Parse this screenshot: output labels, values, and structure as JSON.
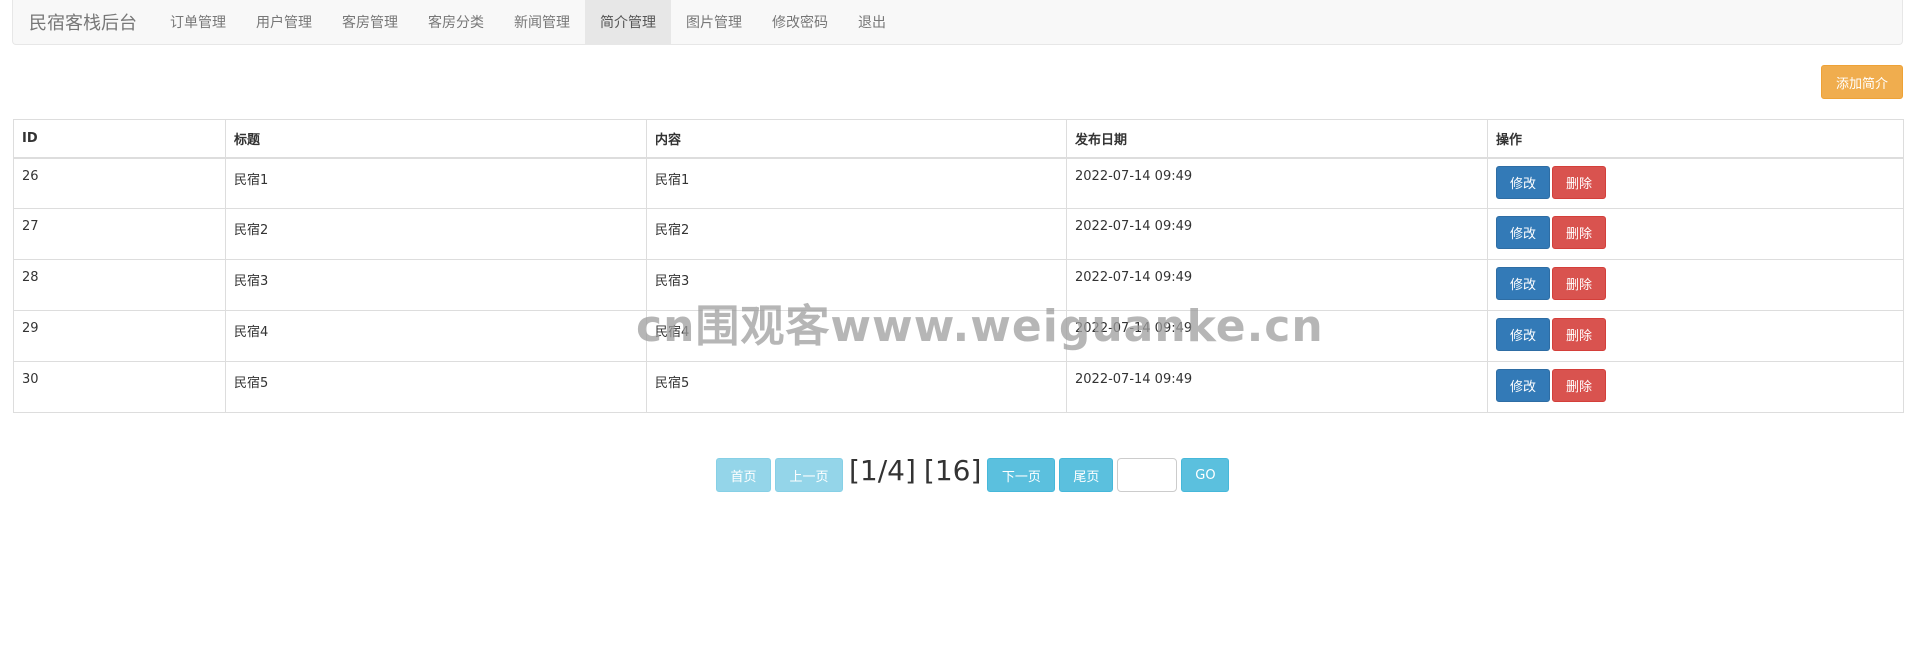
{
  "navbar": {
    "brand": "民宿客栈后台",
    "items": [
      {
        "label": "订单管理",
        "active": false
      },
      {
        "label": "用户管理",
        "active": false
      },
      {
        "label": "客房管理",
        "active": false
      },
      {
        "label": "客房分类",
        "active": false
      },
      {
        "label": "新闻管理",
        "active": false
      },
      {
        "label": "简介管理",
        "active": true
      },
      {
        "label": "图片管理",
        "active": false
      },
      {
        "label": "修改密码",
        "active": false
      },
      {
        "label": "退出",
        "active": false
      }
    ]
  },
  "toolbar": {
    "add_label": "添加简介"
  },
  "table": {
    "headers": [
      "ID",
      "标题",
      "内容",
      "发布日期",
      "操作"
    ],
    "edit_label": "修改",
    "delete_label": "删除",
    "rows": [
      {
        "id": "26",
        "title": "民宿1",
        "content": "民宿1",
        "date": "2022-07-14 09:49"
      },
      {
        "id": "27",
        "title": "民宿2",
        "content": "民宿2",
        "date": "2022-07-14 09:49"
      },
      {
        "id": "28",
        "title": "民宿3",
        "content": "民宿3",
        "date": "2022-07-14 09:49"
      },
      {
        "id": "29",
        "title": "民宿4",
        "content": "民宿4",
        "date": "2022-07-14 09:49"
      },
      {
        "id": "30",
        "title": "民宿5",
        "content": "民宿5",
        "date": "2022-07-14 09:49"
      }
    ]
  },
  "pager": {
    "first": "首页",
    "prev": "上一页",
    "page_info": "[1/4]",
    "total": "[16]",
    "next": "下一页",
    "last": "尾页",
    "jump_value": "",
    "go": "GO"
  },
  "watermark": "cn围观客www.weiguanke.cn"
}
